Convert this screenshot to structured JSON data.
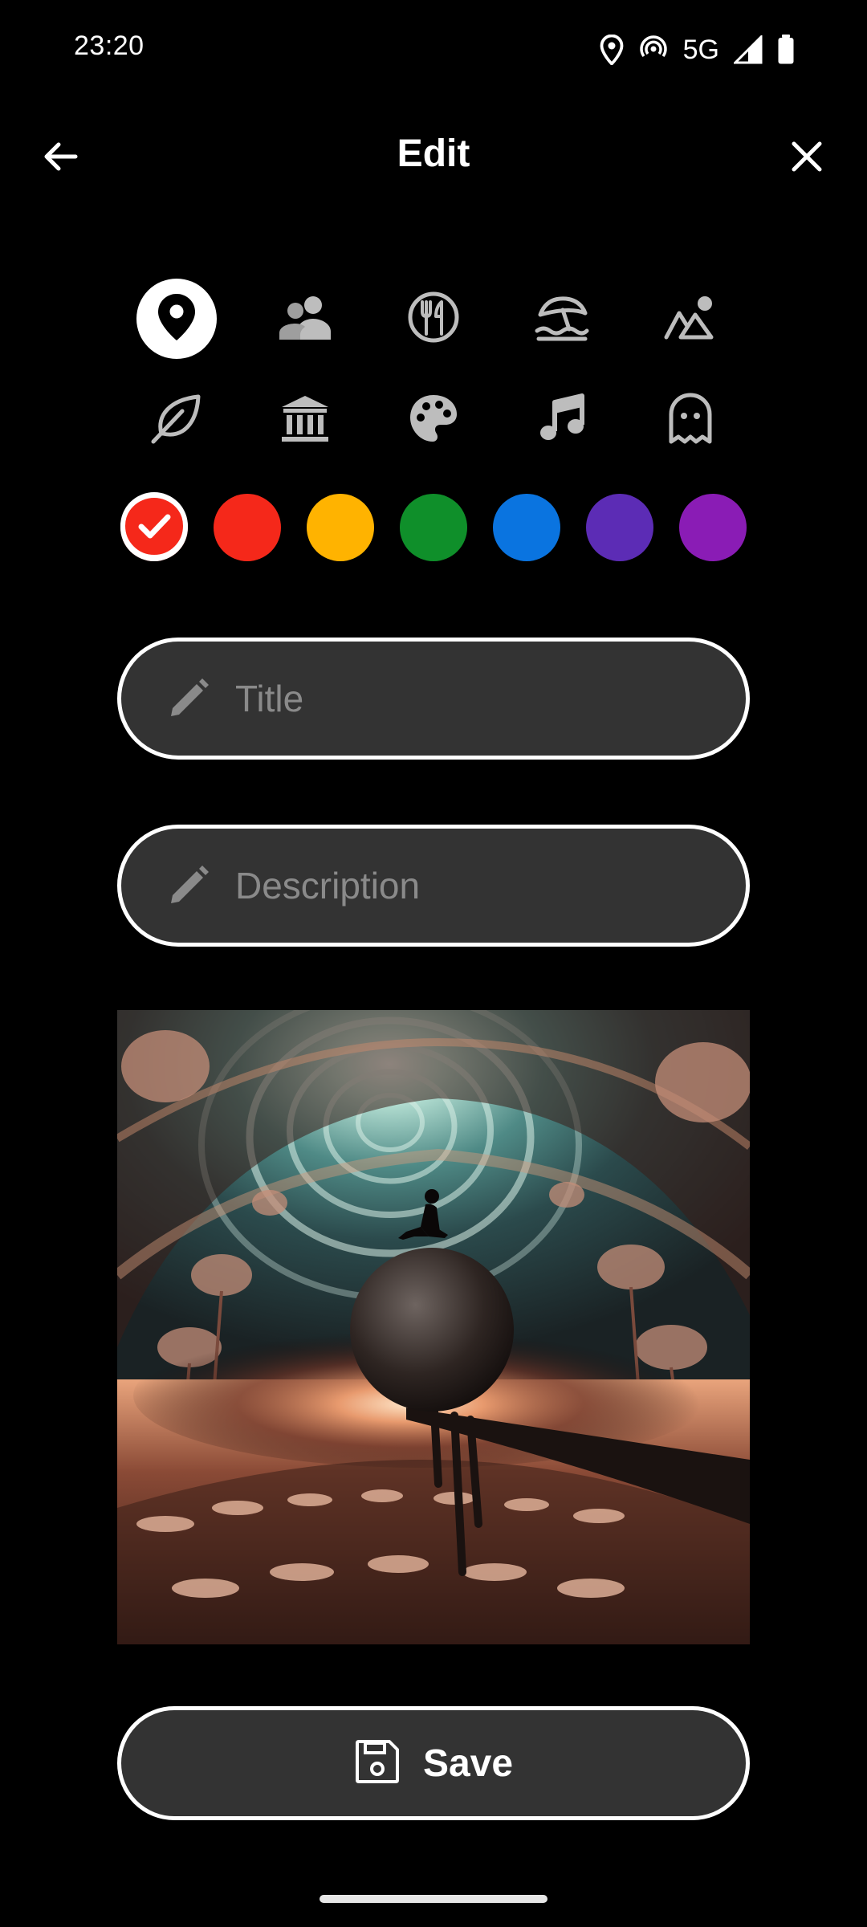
{
  "status_bar": {
    "time": "23:20",
    "network": "5G",
    "icons": [
      "location-icon",
      "hotspot-icon",
      "signal-icon",
      "battery-icon"
    ]
  },
  "header": {
    "title": "Edit",
    "back_icon": "arrow-left-icon",
    "close_icon": "close-icon"
  },
  "categories": [
    {
      "name": "location",
      "icon": "map-pin-icon",
      "selected": true
    },
    {
      "name": "people",
      "icon": "people-icon",
      "selected": false
    },
    {
      "name": "food",
      "icon": "restaurant-icon",
      "selected": false
    },
    {
      "name": "beach",
      "icon": "beach-umbrella-icon",
      "selected": false
    },
    {
      "name": "nature",
      "icon": "mountain-shapes-icon",
      "selected": false
    },
    {
      "name": "park",
      "icon": "leaf-icon",
      "selected": false
    },
    {
      "name": "museum",
      "icon": "museum-icon",
      "selected": false
    },
    {
      "name": "art",
      "icon": "palette-icon",
      "selected": false
    },
    {
      "name": "music",
      "icon": "music-note-icon",
      "selected": false
    },
    {
      "name": "spooky",
      "icon": "ghost-icon",
      "selected": false
    }
  ],
  "colors": [
    {
      "hex": "#f5281a",
      "selected": true
    },
    {
      "hex": "#f5281a",
      "selected": false
    },
    {
      "hex": "#ffb300",
      "selected": false
    },
    {
      "hex": "#0f8f2a",
      "selected": false
    },
    {
      "hex": "#0a74e0",
      "selected": false
    },
    {
      "hex": "#5c2cb5",
      "selected": false
    },
    {
      "hex": "#8a1cb5",
      "selected": false
    }
  ],
  "form": {
    "title_placeholder": "Title",
    "title_value": "",
    "description_placeholder": "Description",
    "description_value": ""
  },
  "save_button": {
    "label": "Save",
    "icon": "save-icon"
  }
}
